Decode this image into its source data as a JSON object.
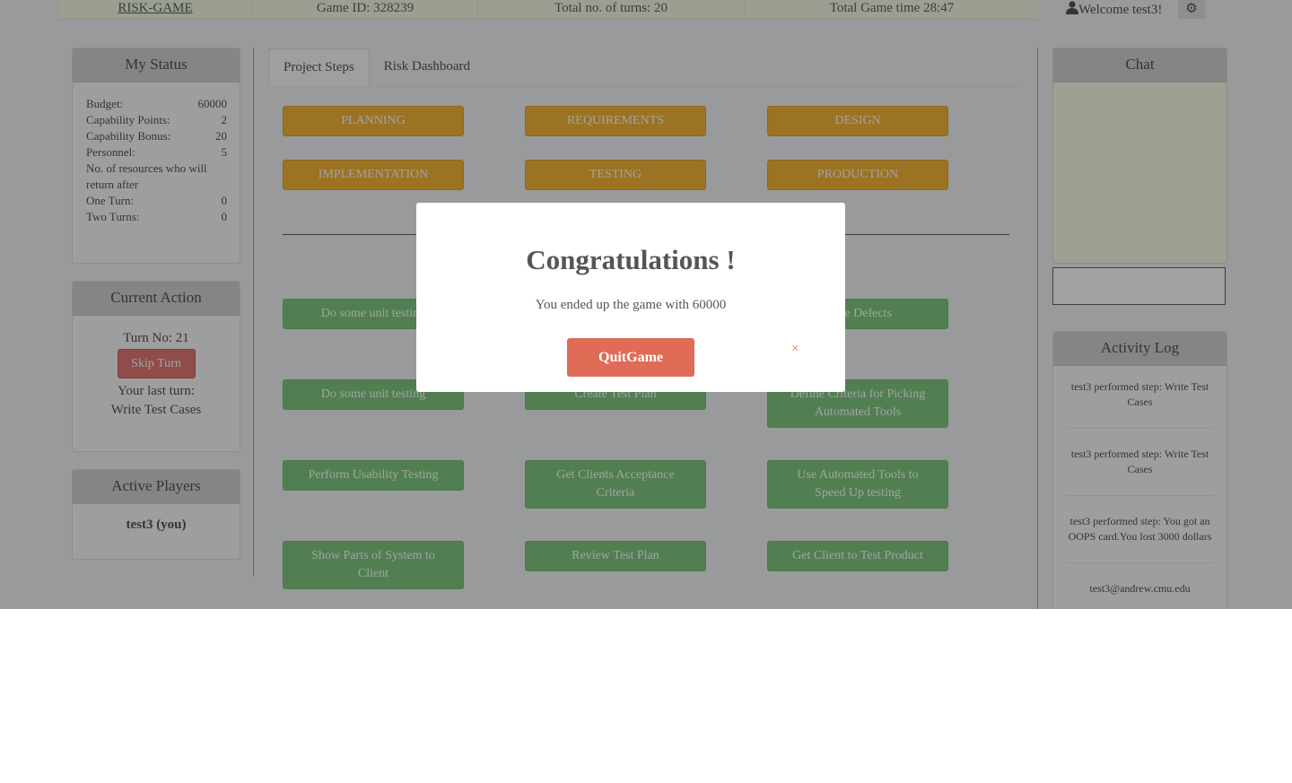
{
  "topbar": {
    "brand": "RISK-GAME",
    "game_id": "Game ID: 328239",
    "turns": "Total no. of turns: 20",
    "time": "Total Game time 28:47",
    "welcome": "Welcome test3!"
  },
  "status": {
    "title": "My Status",
    "rows": [
      {
        "label": "Budget:",
        "value": "60000"
      },
      {
        "label": "Capability Points:",
        "value": "2"
      },
      {
        "label": "Capability Bonus:",
        "value": "20"
      },
      {
        "label": "Personnel:",
        "value": "5"
      }
    ],
    "resources_label": "No. of resources who will return after",
    "one_turn": {
      "label": "One Turn:",
      "value": "0"
    },
    "two_turns": {
      "label": "Two Turns:",
      "value": "0"
    }
  },
  "current_action": {
    "title": "Current Action",
    "turn_no": "Turn No: 21",
    "skip": "Skip Turn",
    "last_label": "Your last turn:",
    "last_value": "Write Test Cases"
  },
  "active_players": {
    "title": "Active Players",
    "player": "test3 (you)"
  },
  "tabs": [
    "Project Steps",
    "Risk Dashboard"
  ],
  "phases": [
    "PLANNING",
    "REQUIREMENTS",
    "DESIGN",
    "IMPLEMENTATION",
    "TESTING",
    "PRODUCTION"
  ],
  "steps": [
    "Do some unit testing",
    "Code Defects",
    "Do some unit testing",
    "Create Test Plan",
    "Define Criteria for Picking Automated Tools",
    "Perform Usability Testing",
    "Get Clients Acceptance Criteria",
    "Use Automated Tools to Speed Up testing",
    "Show Parts of System to Client",
    "Review Test Plan",
    "Get Client to Test Product"
  ],
  "chat": {
    "title": "Chat"
  },
  "activity": {
    "title": "Activity Log",
    "entries": [
      "test3 performed step: Write Test Cases",
      "test3 performed step: Write Test Cases",
      "test3 performed step: You got an OOPS card.You lost 3000 dollars",
      "test3@andrew.cmu.edu"
    ]
  },
  "modal": {
    "title": "Congratulations !",
    "message": "You ended up the game with 60000",
    "quit": "QuitGame",
    "close": "×"
  },
  "colors": {
    "orange_button": "#f0a000",
    "green_button": "#5cb85c",
    "skip_button": "#d9534f",
    "quit_button": "#e06b56"
  }
}
